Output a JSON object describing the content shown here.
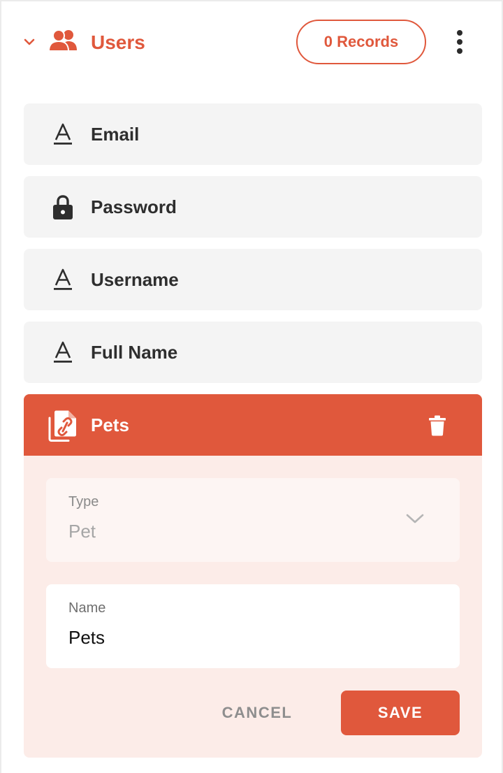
{
  "colors": {
    "accent": "#e0583c",
    "field_bg": "#f4f4f4",
    "expanded_bg": "#fcece8",
    "text_dark": "#2e2e2e"
  },
  "header": {
    "collapse_icon": "chevron-down-icon",
    "icon": "users-icon",
    "title": "Users",
    "records_label": "0 Records",
    "menu_icon": "more-vertical-icon"
  },
  "fields": [
    {
      "icon": "text-field-icon",
      "label": "Email"
    },
    {
      "icon": "lock-icon",
      "label": "Password"
    },
    {
      "icon": "text-field-icon",
      "label": "Username"
    },
    {
      "icon": "text-field-icon",
      "label": "Full Name"
    }
  ],
  "editing_field": {
    "icon": "relation-document-icon",
    "label": "Pets",
    "delete_icon": "trash-icon",
    "type": {
      "label": "Type",
      "value": "Pet",
      "icon": "chevron-down-icon"
    },
    "name": {
      "label": "Name",
      "value": "Pets"
    },
    "cancel_label": "CANCEL",
    "save_label": "SAVE"
  }
}
